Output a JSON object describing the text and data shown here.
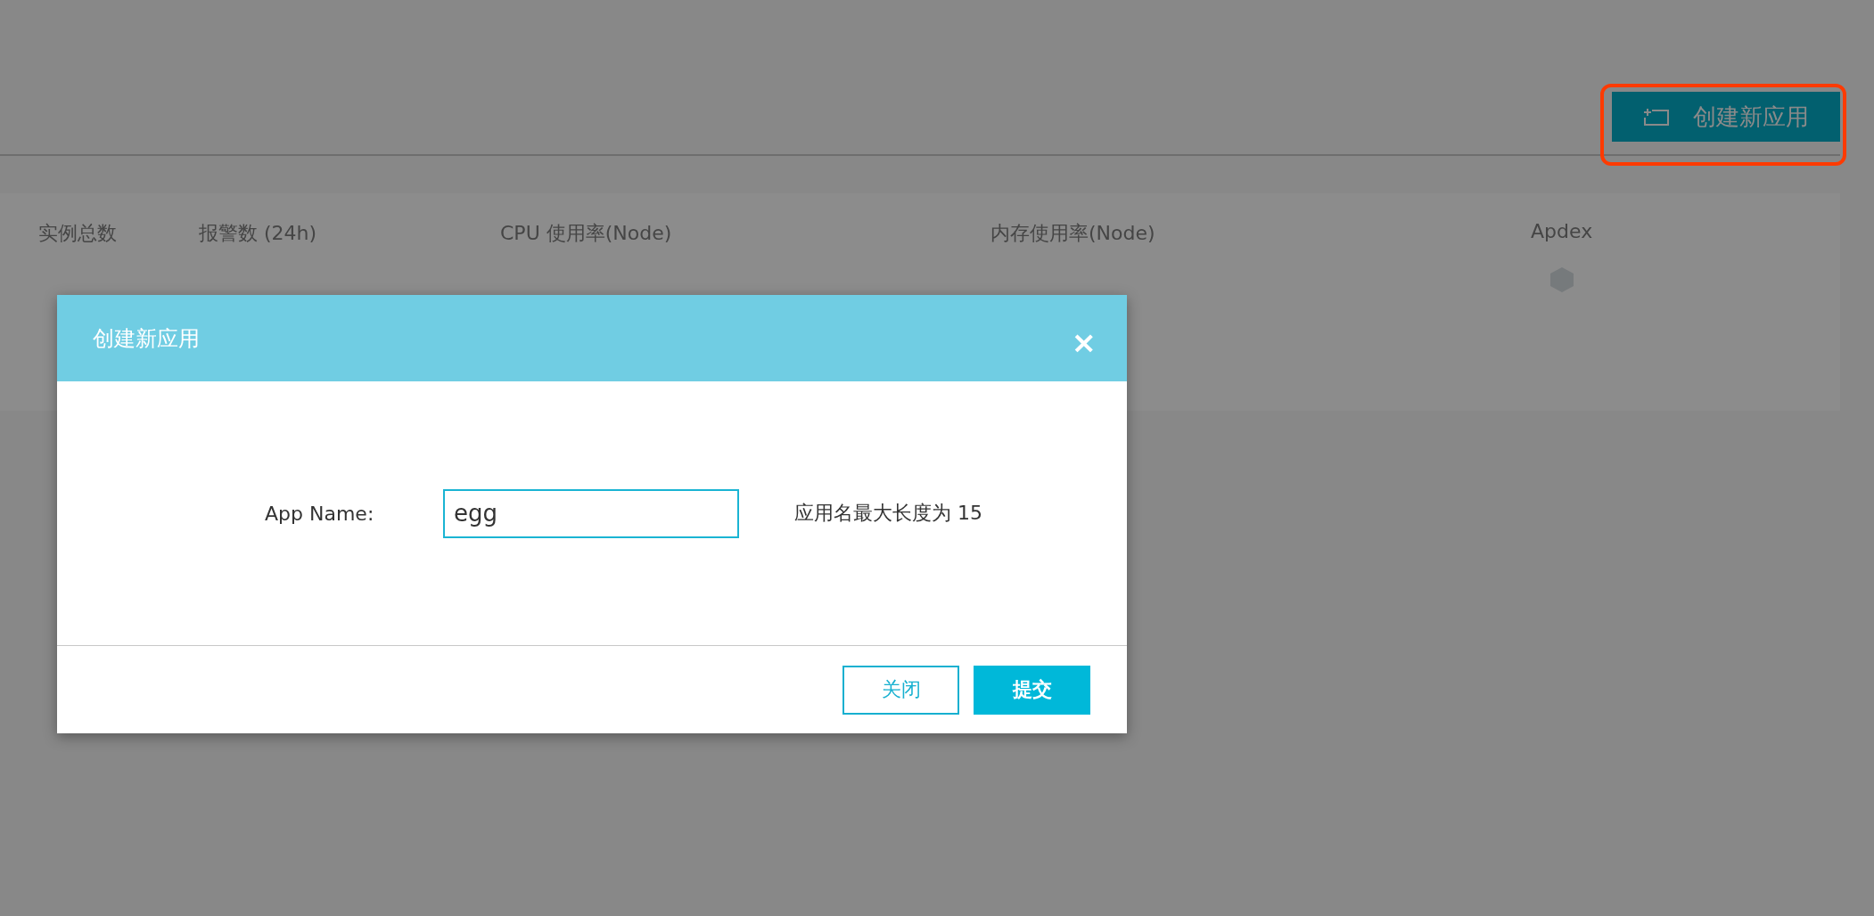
{
  "header": {
    "create_button": "创建新应用"
  },
  "stats": [
    {
      "label": "实例总数"
    },
    {
      "label": "报警数 (24h)"
    },
    {
      "label": "CPU 使用率(Node)"
    },
    {
      "label": "内存使用率(Node)"
    },
    {
      "label": "Apdex",
      "kind": "hexagon"
    }
  ],
  "dialog": {
    "title": "创建新应用",
    "close": "×",
    "field": {
      "label": "App Name:",
      "value": "egg",
      "hint": "应用名最大长度为 15"
    },
    "buttons": [
      {
        "label": "关闭",
        "kind": "secondary"
      },
      {
        "label": "提交",
        "kind": "primary"
      }
    ]
  }
}
